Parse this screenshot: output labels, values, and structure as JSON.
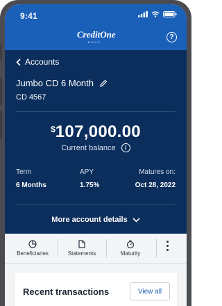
{
  "status_bar": {
    "time": "9:41"
  },
  "header": {
    "brand": "CreditOne",
    "brand_sub": "BANK"
  },
  "account": {
    "back_label": "Accounts",
    "name": "Jumbo CD 6 Month",
    "number": "CD 4567",
    "currency_symbol": "$",
    "balance": "107,000.00",
    "balance_label": "Current balance",
    "stats": [
      {
        "label": "Term",
        "value": "6 Months"
      },
      {
        "label": "APY",
        "value": "1.75%"
      },
      {
        "label": "Matures on:",
        "value": "Oct 28, 2022"
      }
    ],
    "more_details_label": "More account details"
  },
  "actions": [
    {
      "label": "Beneficiaries",
      "icon": "pie-chart-icon"
    },
    {
      "label": "Statements",
      "icon": "document-icon"
    },
    {
      "label": "Maturity",
      "icon": "timer-icon"
    }
  ],
  "transactions": {
    "title": "Recent transactions",
    "view_all_label": "View all"
  },
  "colors": {
    "brand_blue": "#1b60b8",
    "navy": "#0b2e5c",
    "link": "#1b60b8"
  }
}
